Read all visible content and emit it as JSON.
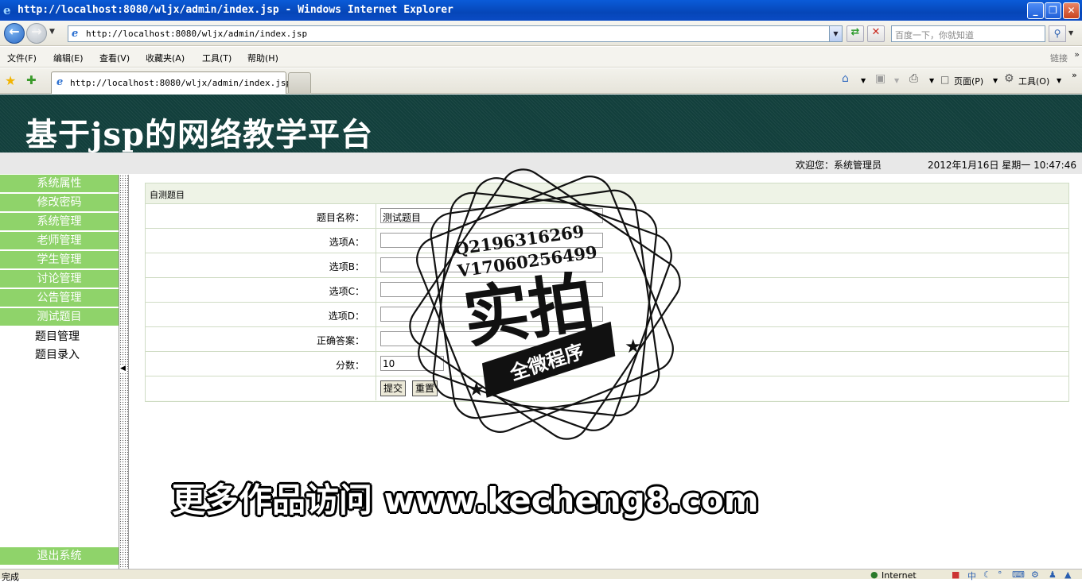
{
  "window": {
    "title": "http://localhost:8080/wljx/admin/index.jsp - Windows Internet Explorer",
    "controls": [
      "_",
      "❐",
      "✕"
    ]
  },
  "addressbar": {
    "url": "http://localhost:8080/wljx/admin/index.jsp",
    "search_placeholder": "百度一下，你就知道"
  },
  "menu": {
    "items": [
      "文件(F)",
      "编辑(E)",
      "查看(V)",
      "收藏夹(A)",
      "工具(T)",
      "帮助(H)"
    ],
    "links": "链接",
    "more": "»"
  },
  "tabs": {
    "active_label": "http://localhost:8080/wljx/admin/index.jsp"
  },
  "commandbar": {
    "page_label": "页面(P)",
    "tools_label": "工具(O)",
    "more": "»"
  },
  "site": {
    "title": "基于jsp的网络教学平台",
    "welcome": "欢迎您：系统管理员",
    "datetime": "2012年1月16日  星期一  10:47:46"
  },
  "sidebar": {
    "items": [
      "系统属性",
      "修改密码",
      "系统管理",
      "老师管理",
      "学生管理",
      "讨论管理",
      "公告管理",
      "测试题目"
    ],
    "subitems": [
      "题目管理",
      "题目录入"
    ],
    "logout": "退出系统"
  },
  "form": {
    "header": "自测题目",
    "labels": [
      "题目名称：",
      "选项A：",
      "选项B：",
      "选项C：",
      "选项D：",
      "正确答案：",
      "分数："
    ],
    "values": {
      "title": "测试题目",
      "option_a": "",
      "option_b": "",
      "option_c": "",
      "option_d": "",
      "answer": "",
      "score": "10"
    },
    "submit_label": "提交",
    "reset_label": "重置"
  },
  "watermark": {
    "qq": "Q2196316269",
    "wechat": "V17060256499",
    "big_text": "实拍",
    "ribbon": "全微程序",
    "promo": "更多作品访问 www.kecheng8.com"
  },
  "statusbar": {
    "status": "完成",
    "zone": "Internet"
  },
  "colors": {
    "banner": "#123f3c",
    "sidebar_green": "#8fd36a",
    "titlebar_blue": "#0a5bd8"
  }
}
